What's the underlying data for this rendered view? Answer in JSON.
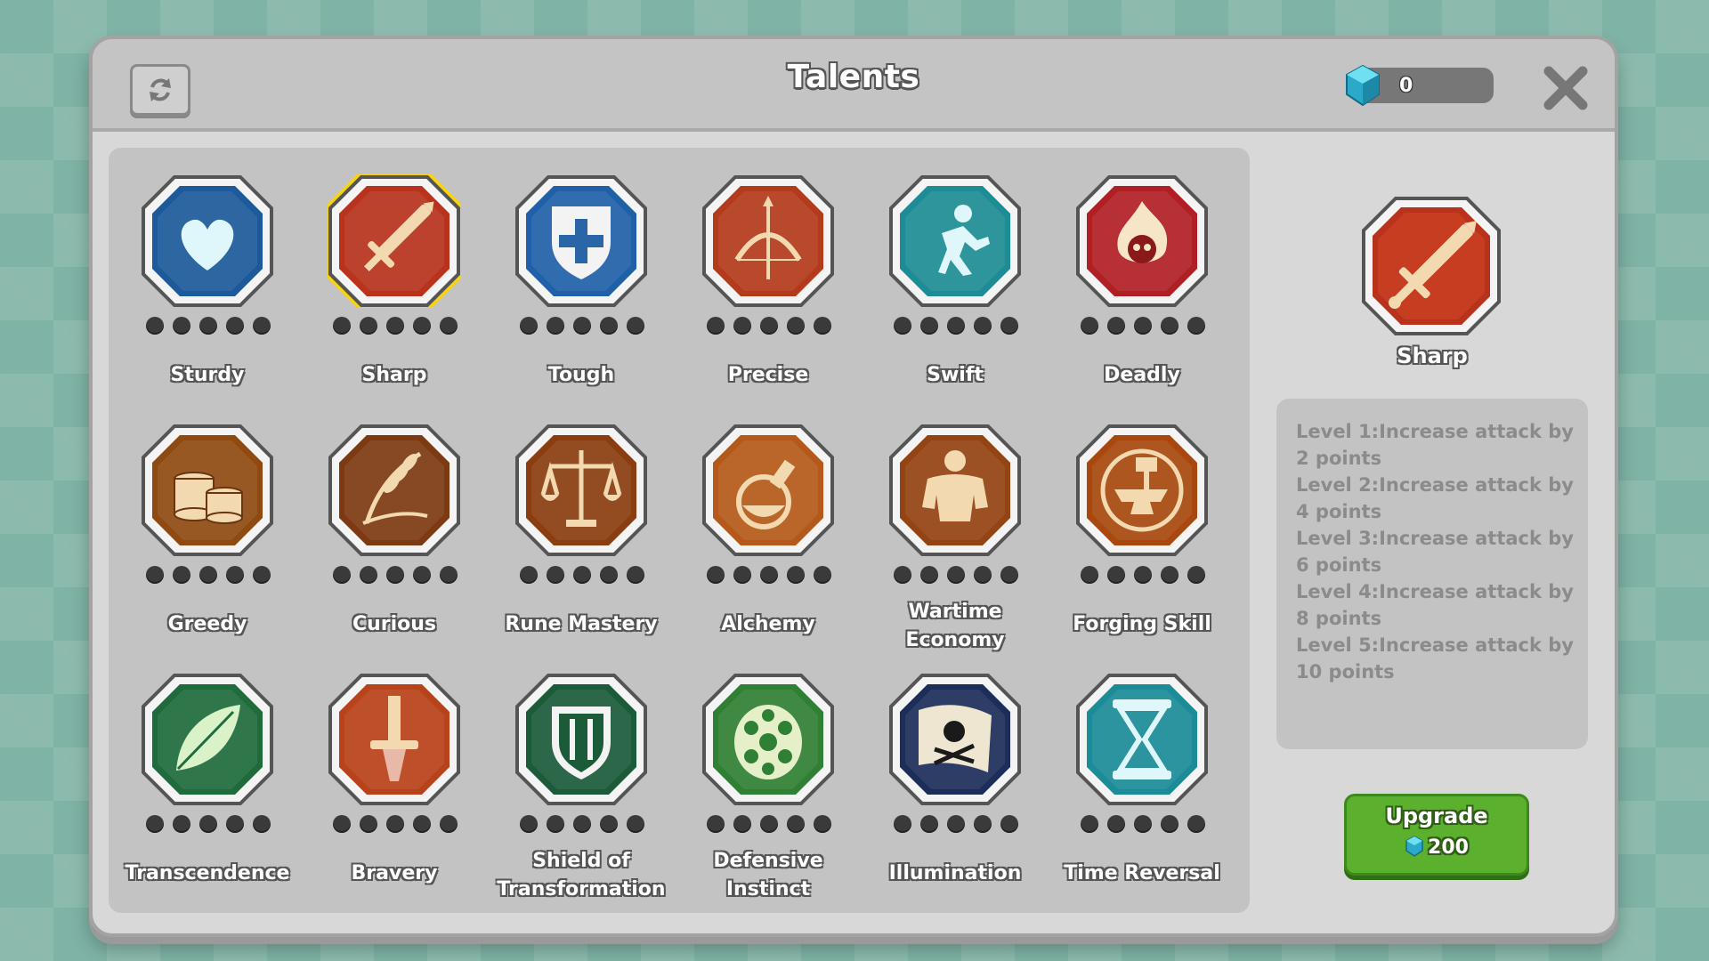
{
  "header": {
    "title": "Talents",
    "gem_count": "0"
  },
  "talents": [
    {
      "name": "Sturdy",
      "bg": "#1d5a9b",
      "icon": "frozen-heart-icon"
    },
    {
      "name": "Sharp",
      "bg": "#b8321c",
      "icon": "sword-icon"
    },
    {
      "name": "Tough",
      "bg": "#1f60a8",
      "icon": "shield-cross-icon"
    },
    {
      "name": "Precise",
      "bg": "#b43a1c",
      "icon": "bow-arrow-icon"
    },
    {
      "name": "Swift",
      "bg": "#1e8c95",
      "icon": "runner-icon"
    },
    {
      "name": "Deadly",
      "bg": "#b01f24",
      "icon": "flaming-skull-icon"
    },
    {
      "name": "Greedy",
      "bg": "#8f4a12",
      "icon": "coin-stacks-icon"
    },
    {
      "name": "Curious",
      "bg": "#7d3a12",
      "icon": "wheat-icon"
    },
    {
      "name": "Rune Mastery",
      "bg": "#8a3d10",
      "icon": "balance-scale-icon"
    },
    {
      "name": "Alchemy",
      "bg": "#b5591a",
      "icon": "potion-flask-icon"
    },
    {
      "name": "Wartime\nEconomy",
      "bg": "#944312",
      "icon": "strongman-icon"
    },
    {
      "name": "Forging Skill",
      "bg": "#a8480e",
      "icon": "anvil-hammer-icon"
    },
    {
      "name": "Transcendence",
      "bg": "#1f6b3c",
      "icon": "leaf-icon"
    },
    {
      "name": "Bravery",
      "bg": "#b8421a",
      "icon": "dagger-icon"
    },
    {
      "name": "Shield of\nTransformation",
      "bg": "#1c5b3a",
      "icon": "green-shield-icon"
    },
    {
      "name": "Defensive\nInstinct",
      "bg": "#2f7f34",
      "icon": "turtle-shell-icon"
    },
    {
      "name": "Illumination",
      "bg": "#1c2d5a",
      "icon": "pirate-flag-icon"
    },
    {
      "name": "Time Reversal",
      "bg": "#1b8b97",
      "icon": "hourglass-icon"
    }
  ],
  "selected": {
    "name": "Sharp",
    "levels": [
      "Level 1:Increase attack by 2 points",
      "Level 2:Increase attack by 4 points",
      "Level 3:Increase attack by 6 points",
      "Level 4:Increase attack by 8 points",
      "Level 5:Increase attack by 10 points"
    ]
  },
  "upgrade": {
    "label": "Upgrade",
    "cost": "200"
  },
  "colors": {
    "selected_outline": "#f7d310",
    "upgrade_green": "#5bb12e",
    "dot_empty": "#3a3a3a"
  }
}
